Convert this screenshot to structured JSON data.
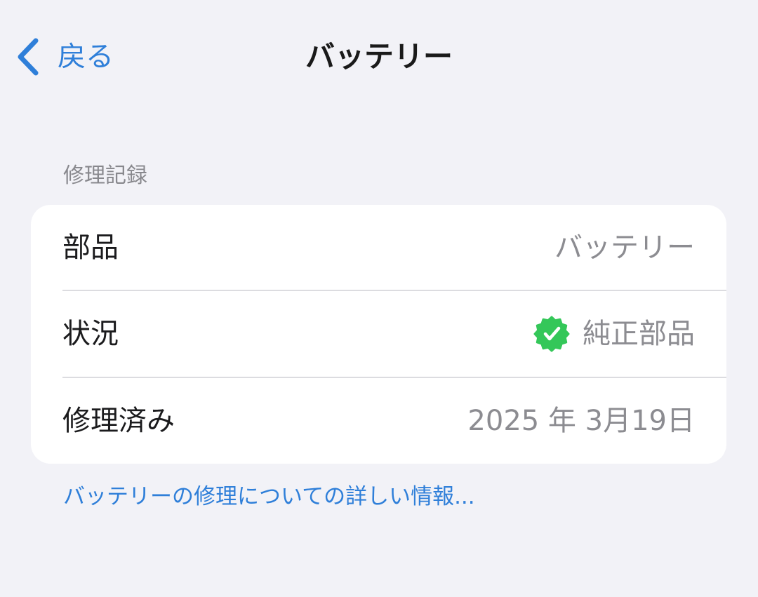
{
  "nav": {
    "back_label": "戻る",
    "title": "バッテリー"
  },
  "section": {
    "header": "修理記録",
    "rows": [
      {
        "label": "部品",
        "value": "バッテリー"
      },
      {
        "label": "状況",
        "value": "純正部品",
        "icon": "verified-check-badge-icon"
      },
      {
        "label": "修理済み",
        "value": "2025 年 3月19日"
      }
    ]
  },
  "footer": {
    "link_label": "バッテリーの修理についての詳しい情報..."
  },
  "colors": {
    "background": "#f2f2f7",
    "accent": "#2f7fd9",
    "badge_green": "#34c759",
    "secondary_text": "#8c8c91"
  }
}
